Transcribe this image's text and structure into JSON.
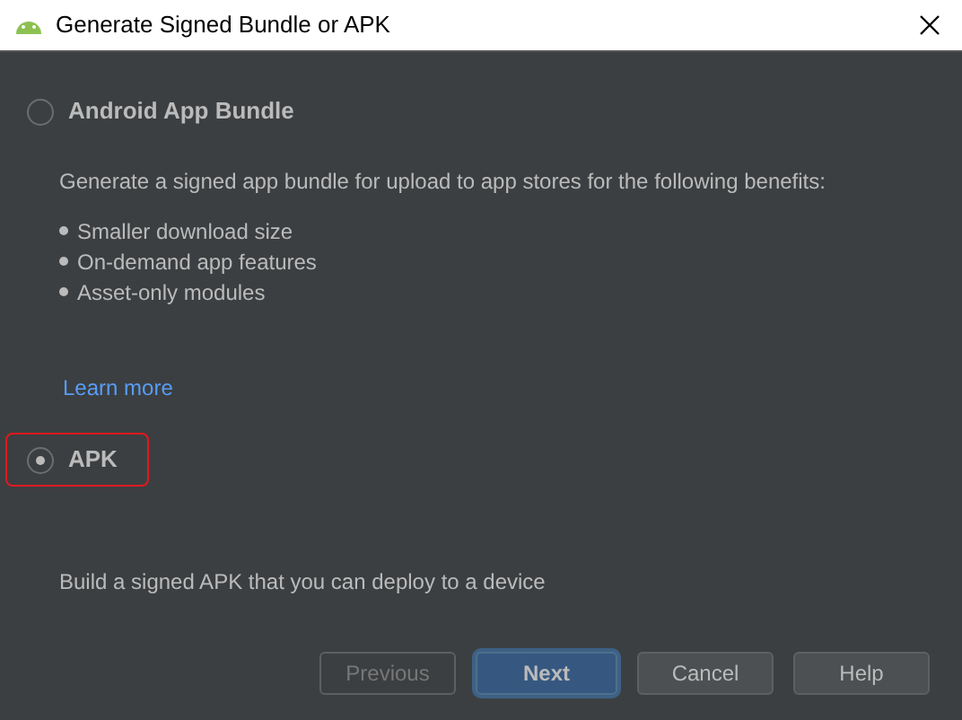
{
  "window": {
    "title": "Generate Signed Bundle or APK"
  },
  "options": [
    {
      "label": "Android App Bundle",
      "selected": false,
      "description": "Generate a signed app bundle for upload to app stores for the following benefits:",
      "bullets": [
        "Smaller download size",
        "On-demand app features",
        "Asset-only modules"
      ],
      "link": "Learn more"
    },
    {
      "label": "APK",
      "selected": true,
      "description": "Build a signed APK that you can deploy to a device"
    }
  ],
  "buttons": [
    {
      "label": "Previous",
      "disabled": true,
      "primary": false
    },
    {
      "label": "Next",
      "disabled": false,
      "primary": true
    },
    {
      "label": "Cancel",
      "disabled": false,
      "primary": false
    },
    {
      "label": "Help",
      "disabled": false,
      "primary": false
    }
  ]
}
